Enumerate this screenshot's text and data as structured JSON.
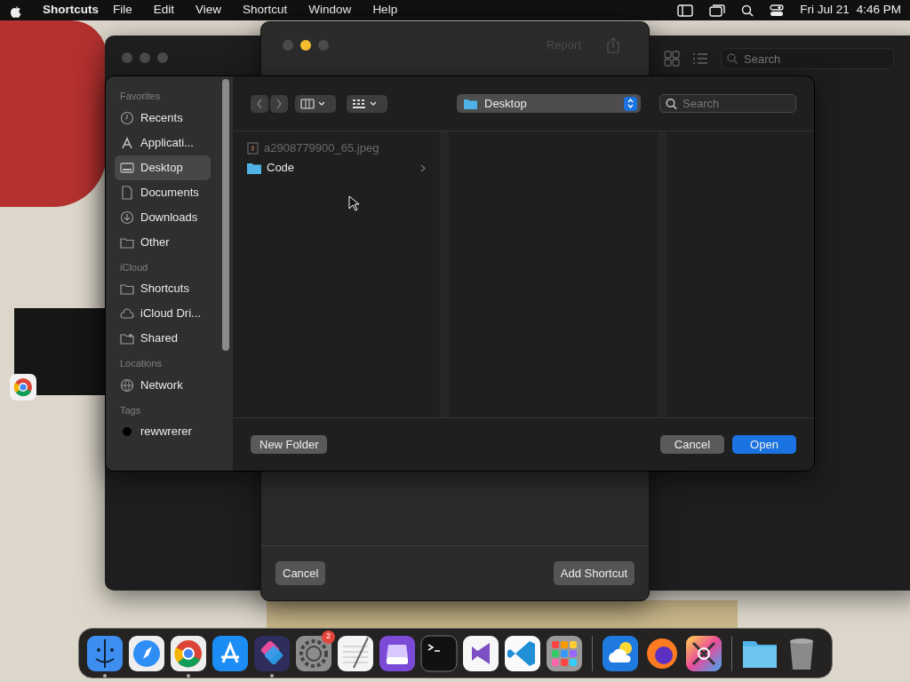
{
  "menu_bar": {
    "app_name": "Shortcuts",
    "menus": [
      "File",
      "Edit",
      "View",
      "Shortcut",
      "Window",
      "Help"
    ],
    "date": "Fri Jul 21",
    "time": "4:46 PM"
  },
  "main_window": {
    "search": {
      "placeholder": "Search"
    }
  },
  "sheet": {
    "header_action": "Report",
    "buttons": [
      {
        "label": "Cancel"
      },
      {
        "label": "Add Shortcut"
      }
    ]
  },
  "open_dialog": {
    "sidebar": [
      {
        "heading": "Favorites",
        "items": [
          {
            "label": "Recents",
            "kind": "clock",
            "selected": false
          },
          {
            "label": "Applicati...",
            "kind": "apps",
            "selected": false
          },
          {
            "label": "Desktop",
            "kind": "desktop",
            "selected": true
          },
          {
            "label": "Documents",
            "kind": "document",
            "selected": false
          },
          {
            "label": "Downloads",
            "kind": "download",
            "selected": false
          },
          {
            "label": "Other",
            "kind": "folder",
            "selected": false
          }
        ]
      },
      {
        "heading": "iCloud",
        "items": [
          {
            "label": "Shortcuts",
            "kind": "folder",
            "selected": false
          },
          {
            "label": "iCloud Dri...",
            "kind": "cloud",
            "selected": false
          },
          {
            "label": "Shared",
            "kind": "shared",
            "selected": false
          }
        ]
      },
      {
        "heading": "Locations",
        "items": [
          {
            "label": "Network",
            "kind": "network",
            "selected": false
          }
        ]
      },
      {
        "heading": "Tags",
        "items": [
          {
            "label": "rewwrerer",
            "kind": "tag",
            "color": "#000000",
            "selected": false
          }
        ]
      }
    ],
    "location": "Desktop",
    "search": {
      "placeholder": "Search"
    },
    "files": [
      {
        "name": "a2908779900_65.jpeg",
        "kind": "image",
        "disabled": true
      },
      {
        "name": "Code",
        "kind": "folder",
        "disabled": false
      }
    ],
    "buttons": [
      {
        "label": "New Folder",
        "kind": "secondary"
      },
      {
        "label": "Cancel",
        "kind": "secondary"
      },
      {
        "label": "Open",
        "kind": "primary"
      }
    ]
  },
  "dock": [
    {
      "kind": "finder",
      "running": true
    },
    {
      "kind": "compass",
      "running": false
    },
    {
      "kind": "ring",
      "running": true
    },
    {
      "kind": "store",
      "running": false
    },
    {
      "kind": "layers",
      "running": true
    },
    {
      "kind": "gear",
      "running": false,
      "badge": "2"
    },
    {
      "kind": "notepad",
      "running": false
    },
    {
      "kind": "tray",
      "running": false
    },
    {
      "kind": "terminal",
      "running": false
    },
    {
      "kind": "ribbon",
      "running": false
    },
    {
      "kind": "code",
      "running": false
    },
    {
      "kind": "grid",
      "running": false
    },
    {
      "kind": "sep"
    },
    {
      "kind": "weather",
      "running": false
    },
    {
      "kind": "fox",
      "running": false
    },
    {
      "kind": "tools",
      "running": false
    },
    {
      "kind": "sep"
    },
    {
      "kind": "folder",
      "running": false
    },
    {
      "kind": "trash",
      "running": false
    }
  ]
}
